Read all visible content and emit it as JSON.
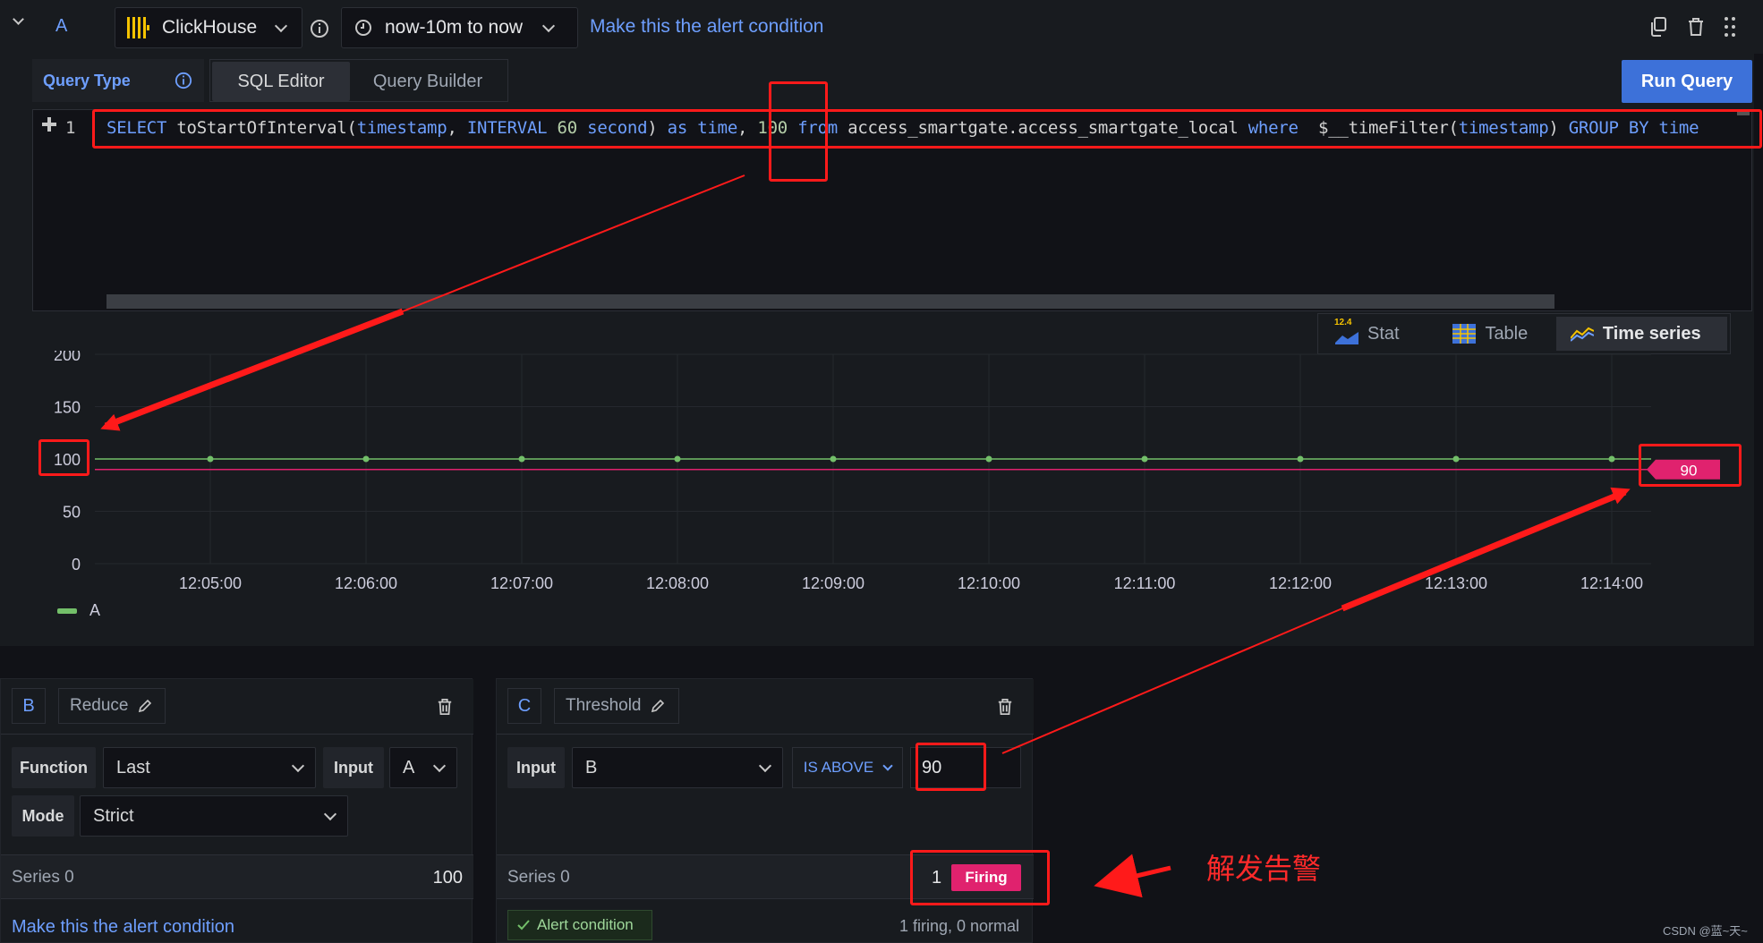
{
  "header": {
    "query_ref": "A",
    "datasource": "ClickHouse",
    "time_range": "now-10m to now",
    "alert_condition_link": "Make this the alert condition"
  },
  "query": {
    "type_label": "Query Type",
    "tabs": [
      {
        "label": "SQL Editor",
        "active": true
      },
      {
        "label": "Query Builder",
        "active": false
      }
    ],
    "run_label": "Run Query",
    "line_number": "1",
    "sql_tokens": [
      {
        "t": "SELECT",
        "c": "kw"
      },
      {
        "t": " toStartOfInterval(",
        "c": "txt"
      },
      {
        "t": "timestamp",
        "c": "kw"
      },
      {
        "t": ", ",
        "c": "txt"
      },
      {
        "t": "INTERVAL",
        "c": "kw"
      },
      {
        "t": " ",
        "c": "txt"
      },
      {
        "t": "60",
        "c": "num"
      },
      {
        "t": " ",
        "c": "txt"
      },
      {
        "t": "second",
        "c": "kw"
      },
      {
        "t": ") ",
        "c": "txt"
      },
      {
        "t": "as",
        "c": "kw"
      },
      {
        "t": " ",
        "c": "txt"
      },
      {
        "t": "time",
        "c": "kw"
      },
      {
        "t": ", ",
        "c": "txt"
      },
      {
        "t": "100",
        "c": "num"
      },
      {
        "t": " ",
        "c": "txt"
      },
      {
        "t": "from",
        "c": "kw"
      },
      {
        "t": " access_smartgate.access_smartgate_local ",
        "c": "txt"
      },
      {
        "t": "where",
        "c": "kw"
      },
      {
        "t": "  $__timeFilter(",
        "c": "txt"
      },
      {
        "t": "timestamp",
        "c": "kw"
      },
      {
        "t": ") ",
        "c": "txt"
      },
      {
        "t": "GROUP BY",
        "c": "kw"
      },
      {
        "t": " ",
        "c": "txt"
      },
      {
        "t": "time",
        "c": "kw"
      }
    ]
  },
  "viz": {
    "buttons": [
      {
        "label": "Stat",
        "badge": "12.4",
        "active": false
      },
      {
        "label": "Table",
        "active": false
      },
      {
        "label": "Time series",
        "active": true
      }
    ]
  },
  "chart_data": {
    "type": "line",
    "x": [
      "12:05:00",
      "12:06:00",
      "12:07:00",
      "12:08:00",
      "12:09:00",
      "12:10:00",
      "12:11:00",
      "12:12:00",
      "12:13:00",
      "12:14:00"
    ],
    "yticks": [
      "0",
      "50",
      "100",
      "150",
      "200"
    ],
    "ylim": [
      0,
      200
    ],
    "series": [
      {
        "name": "A",
        "values": [
          100,
          100,
          100,
          100,
          100,
          100,
          100,
          100,
          100,
          100
        ],
        "color": "#73bf69"
      }
    ],
    "threshold": {
      "value": 90,
      "label": "90",
      "color": "#e0226e"
    },
    "grid": true,
    "legend": "bottom-left"
  },
  "reduce": {
    "ref": "B",
    "name": "Reduce",
    "function_label": "Function",
    "function_value": "Last",
    "input_label": "Input",
    "input_value": "A",
    "mode_label": "Mode",
    "mode_value": "Strict",
    "series_label": "Series 0",
    "series_value": "100",
    "alert_link": "Make this the alert condition"
  },
  "threshold": {
    "ref": "C",
    "name": "Threshold",
    "input_label": "Input",
    "input_value": "B",
    "op_label": "IS ABOVE",
    "value": "90",
    "series_label": "Series 0",
    "count": "1",
    "state": "Firing",
    "alert_badge": "Alert condition",
    "summary": "1 firing, 0 normal"
  },
  "annotation": {
    "text": "解发告警"
  },
  "watermark": "CSDN @蓝~天~"
}
